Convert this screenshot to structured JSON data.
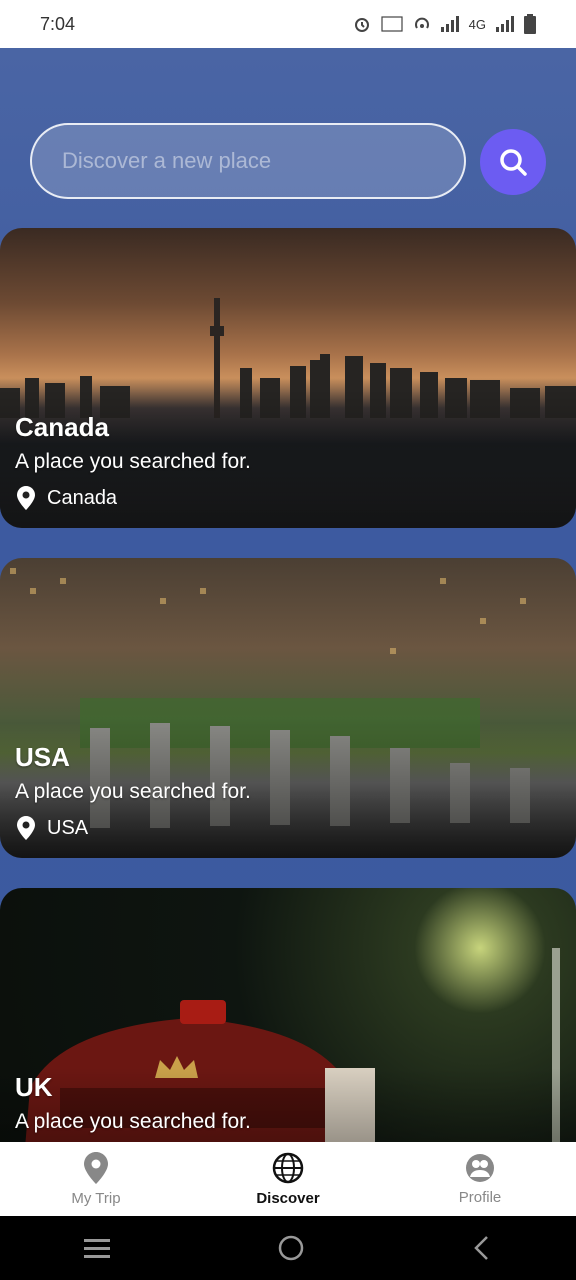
{
  "status_bar": {
    "time": "7:04",
    "network": "4G"
  },
  "search": {
    "placeholder": "Discover a new place"
  },
  "cards": [
    {
      "title": "Canada",
      "subtitle": "A place you searched for.",
      "location": "Canada"
    },
    {
      "title": "USA",
      "subtitle": "A place you searched for.",
      "location": "USA"
    },
    {
      "title": "UK",
      "subtitle": "A place you searched for."
    }
  ],
  "bottom_nav": {
    "items": [
      {
        "label": "My Trip",
        "icon": "location-pin-icon",
        "active": false
      },
      {
        "label": "Discover",
        "icon": "globe-icon",
        "active": true
      },
      {
        "label": "Profile",
        "icon": "profile-icon",
        "active": false
      }
    ]
  },
  "colors": {
    "accent": "#6c5cf2",
    "background": "#3d5aa0"
  }
}
